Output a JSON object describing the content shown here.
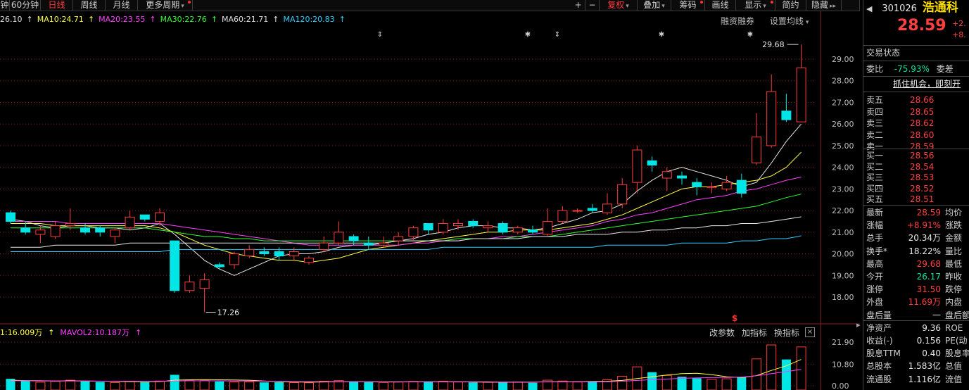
{
  "toolbar": {
    "tabs": [
      {
        "label": "钟",
        "x": 0,
        "w": 14
      },
      {
        "label": "60分钟",
        "x": 14,
        "w": 44
      },
      {
        "label": "日线",
        "x": 58,
        "w": 46,
        "active": true
      },
      {
        "label": "周线",
        "x": 104,
        "w": 46
      },
      {
        "label": "月线",
        "x": 150,
        "w": 46
      },
      {
        "label": "更多周期",
        "x": 196,
        "w": 78,
        "dot": true,
        "dropdown": true
      }
    ],
    "right_buttons": [
      {
        "label": "+",
        "x": 812,
        "w": 20
      },
      {
        "label": "−",
        "x": 832,
        "w": 20
      },
      {
        "label": "复权",
        "x": 852,
        "w": 54,
        "active": true,
        "dropdown": true
      },
      {
        "label": "叠加",
        "x": 906,
        "w": 48,
        "dropdown": true
      },
      {
        "label": "筹码",
        "x": 954,
        "w": 48,
        "dot": true
      },
      {
        "label": "画线",
        "x": 1002,
        "w": 44
      },
      {
        "label": "显示",
        "x": 1046,
        "w": 56,
        "dot": true,
        "dropdown": true
      },
      {
        "label": "简约",
        "x": 1102,
        "w": 44
      },
      {
        "label": "隐藏",
        "x": 1146,
        "w": 50,
        "arrow": "▸▸"
      },
      {
        "label": "",
        "x": 1196,
        "w": 26
      }
    ]
  },
  "ma_legend": [
    {
      "text": "26.10",
      "color": "#e0e0e0"
    },
    {
      "text": "MA10:24.71",
      "color": "#ffff40"
    },
    {
      "text": "MA20:23.55",
      "color": "#ff40ff"
    },
    {
      "text": "MA30:22.76",
      "color": "#30ff30"
    },
    {
      "text": "MA60:21.71",
      "color": "#e0e0e0"
    },
    {
      "text": "MA120:20.83",
      "color": "#30d0ff"
    }
  ],
  "main_right_labels": {
    "rzrq": "融资融券",
    "set_ma": "设置均线"
  },
  "price_axis": {
    "ticks": [
      "29.00",
      "28.00",
      "27.00",
      "26.00",
      "25.00",
      "24.00",
      "23.00",
      "22.00",
      "21.00",
      "20.00",
      "19.00",
      "18.00"
    ]
  },
  "annotations": {
    "high": "29.68",
    "low": "17.26",
    "s_marker": "$"
  },
  "volume": {
    "legend": [
      {
        "text": "1:16.009万",
        "color": "#ffff40"
      },
      {
        "text": "MAVOL2:10.187万",
        "color": "#ff40ff"
      }
    ],
    "buttons": [
      "改参数",
      "加指标",
      "换指标"
    ],
    "close": "×",
    "axis_ticks": [
      "21.90",
      "10.80",
      "0.00"
    ]
  },
  "chart_data": {
    "type": "candlestick",
    "ylim": [
      17.3,
      29.7
    ],
    "candles": [
      {
        "o": 21.9,
        "c": 21.5,
        "h": 22.0,
        "l": 21.4
      },
      {
        "o": 21.2,
        "c": 21.0,
        "h": 21.5,
        "l": 20.9
      },
      {
        "o": 20.9,
        "c": 21.1,
        "h": 21.3,
        "l": 20.5
      },
      {
        "o": 20.8,
        "c": 21.3,
        "h": 21.5,
        "l": 20.7
      },
      {
        "o": 21.3,
        "c": 21.4,
        "h": 22.1,
        "l": 21.1
      },
      {
        "o": 21.2,
        "c": 21.0,
        "h": 21.4,
        "l": 20.9
      },
      {
        "o": 21.2,
        "c": 21.0,
        "h": 21.3,
        "l": 20.8
      },
      {
        "o": 20.8,
        "c": 21.1,
        "h": 21.2,
        "l": 20.5
      },
      {
        "o": 21.2,
        "c": 21.7,
        "h": 22.0,
        "l": 21.1
      },
      {
        "o": 21.8,
        "c": 21.6,
        "h": 21.8,
        "l": 21.5
      },
      {
        "o": 21.5,
        "c": 21.9,
        "h": 22.1,
        "l": 21.3
      },
      {
        "o": 20.6,
        "c": 18.3,
        "h": 20.6,
        "l": 18.2
      },
      {
        "o": 18.3,
        "c": 18.7,
        "h": 19.0,
        "l": 18.2
      },
      {
        "o": 18.4,
        "c": 18.8,
        "h": 19.1,
        "l": 17.3
      },
      {
        "o": 19.5,
        "c": 19.4,
        "h": 19.6,
        "l": 19.3
      },
      {
        "o": 19.5,
        "c": 20.0,
        "h": 20.1,
        "l": 19.3
      },
      {
        "o": 19.9,
        "c": 20.2,
        "h": 20.4,
        "l": 19.8
      },
      {
        "o": 20.1,
        "c": 20.0,
        "h": 20.3,
        "l": 19.9
      },
      {
        "o": 20.1,
        "c": 19.9,
        "h": 20.3,
        "l": 19.7
      },
      {
        "o": 19.9,
        "c": 20.1,
        "h": 20.3,
        "l": 19.7
      },
      {
        "o": 19.6,
        "c": 19.8,
        "h": 19.9,
        "l": 19.5
      },
      {
        "o": 20.2,
        "c": 20.5,
        "h": 20.8,
        "l": 20.1
      },
      {
        "o": 20.5,
        "c": 21.0,
        "h": 21.5,
        "l": 20.4
      },
      {
        "o": 20.8,
        "c": 20.6,
        "h": 20.9,
        "l": 20.4
      },
      {
        "o": 20.5,
        "c": 20.4,
        "h": 20.8,
        "l": 20.2
      },
      {
        "o": 20.4,
        "c": 20.5,
        "h": 20.8,
        "l": 20.3
      },
      {
        "o": 20.6,
        "c": 20.8,
        "h": 21.0,
        "l": 20.4
      },
      {
        "o": 20.8,
        "c": 21.2,
        "h": 21.3,
        "l": 20.6
      },
      {
        "o": 21.4,
        "c": 21.1,
        "h": 21.4,
        "l": 20.9
      },
      {
        "o": 21.0,
        "c": 21.4,
        "h": 21.6,
        "l": 20.9
      },
      {
        "o": 21.3,
        "c": 21.4,
        "h": 21.6,
        "l": 21.1
      },
      {
        "o": 21.5,
        "c": 21.3,
        "h": 21.6,
        "l": 21.2
      },
      {
        "o": 21.2,
        "c": 21.3,
        "h": 21.5,
        "l": 21.0
      },
      {
        "o": 21.4,
        "c": 21.0,
        "h": 21.5,
        "l": 20.9
      },
      {
        "o": 21.0,
        "c": 21.2,
        "h": 21.3,
        "l": 20.9
      },
      {
        "o": 21.1,
        "c": 21.0,
        "h": 21.3,
        "l": 20.9
      },
      {
        "o": 20.9,
        "c": 21.5,
        "h": 22.1,
        "l": 20.8
      },
      {
        "o": 21.5,
        "c": 22.0,
        "h": 22.2,
        "l": 21.4
      },
      {
        "o": 22.0,
        "c": 22.0,
        "h": 22.1,
        "l": 21.9
      },
      {
        "o": 22.1,
        "c": 22.0,
        "h": 22.3,
        "l": 21.9
      },
      {
        "o": 21.9,
        "c": 22.3,
        "h": 22.8,
        "l": 21.8
      },
      {
        "o": 22.3,
        "c": 23.2,
        "h": 23.5,
        "l": 22.1
      },
      {
        "o": 23.3,
        "c": 24.8,
        "h": 25.0,
        "l": 22.8
      },
      {
        "o": 24.3,
        "c": 24.1,
        "h": 24.5,
        "l": 23.8
      },
      {
        "o": 23.5,
        "c": 23.8,
        "h": 24.0,
        "l": 22.9
      },
      {
        "o": 23.6,
        "c": 23.5,
        "h": 23.8,
        "l": 23.2
      },
      {
        "o": 23.3,
        "c": 23.1,
        "h": 23.5,
        "l": 22.7
      },
      {
        "o": 23.1,
        "c": 23.1,
        "h": 23.3,
        "l": 22.8
      },
      {
        "o": 23.0,
        "c": 23.3,
        "h": 23.6,
        "l": 22.9
      },
      {
        "o": 23.4,
        "c": 22.8,
        "h": 23.7,
        "l": 22.6
      },
      {
        "o": 24.2,
        "c": 25.4,
        "h": 26.5,
        "l": 24.1
      },
      {
        "o": 25.0,
        "c": 27.5,
        "h": 28.3,
        "l": 24.9
      },
      {
        "o": 26.6,
        "c": 26.2,
        "h": 27.4,
        "l": 26.1
      },
      {
        "o": 26.1,
        "c": 28.6,
        "h": 29.68,
        "l": 26.1
      }
    ],
    "ma_lines": [
      {
        "name": "MA5",
        "color": "#e8e8e8",
        "values": [
          21.6,
          21.5,
          21.3,
          21.2,
          21.3,
          21.3,
          21.2,
          21.2,
          21.1,
          21.2,
          21.4,
          20.9,
          20.3,
          19.7,
          19.3,
          19.0,
          19.3,
          19.6,
          19.9,
          20.0,
          20.0,
          20.1,
          20.3,
          20.4,
          20.4,
          20.5,
          20.6,
          20.7,
          20.9,
          21.0,
          21.2,
          21.3,
          21.3,
          21.2,
          21.2,
          21.1,
          21.2,
          21.4,
          21.6,
          21.9,
          22.0,
          22.3,
          22.9,
          23.4,
          23.8,
          24.0,
          23.8,
          23.6,
          23.4,
          23.1,
          23.3,
          24.2,
          25.2,
          26.0
        ]
      },
      {
        "name": "MA10",
        "color": "#ffff40",
        "values": [
          21.4,
          21.4,
          21.4,
          21.3,
          21.3,
          21.3,
          21.3,
          21.3,
          21.3,
          21.3,
          21.2,
          21.0,
          20.7,
          20.4,
          20.2,
          20.0,
          19.9,
          19.8,
          19.7,
          19.7,
          19.6,
          19.7,
          19.8,
          20.0,
          20.2,
          20.3,
          20.4,
          20.5,
          20.6,
          20.7,
          20.8,
          20.9,
          21.0,
          21.0,
          21.1,
          21.1,
          21.1,
          21.2,
          21.3,
          21.4,
          21.6,
          21.8,
          22.1,
          22.4,
          22.7,
          23.0,
          23.1,
          23.1,
          23.2,
          23.3,
          23.4,
          23.6,
          24.0,
          24.7
        ]
      },
      {
        "name": "MA20",
        "color": "#ff40ff",
        "values": [
          21.5,
          21.5,
          21.5,
          21.5,
          21.4,
          21.4,
          21.4,
          21.4,
          21.4,
          21.4,
          21.4,
          21.3,
          21.2,
          21.1,
          21.0,
          20.9,
          20.8,
          20.7,
          20.6,
          20.5,
          20.4,
          20.4,
          20.4,
          20.4,
          20.4,
          20.4,
          20.4,
          20.5,
          20.5,
          20.6,
          20.6,
          20.7,
          20.7,
          20.8,
          20.8,
          20.9,
          21.0,
          21.1,
          21.2,
          21.3,
          21.5,
          21.6,
          21.8,
          21.9,
          22.1,
          22.3,
          22.5,
          22.6,
          22.7,
          22.9,
          23.0,
          23.2,
          23.4,
          23.55
        ]
      },
      {
        "name": "MA30",
        "color": "#30ff30",
        "values": [
          21.2,
          21.2,
          21.2,
          21.2,
          21.2,
          21.2,
          21.2,
          21.2,
          21.2,
          21.2,
          21.1,
          21.0,
          20.9,
          20.8,
          20.8,
          20.7,
          20.7,
          20.6,
          20.6,
          20.6,
          20.6,
          20.6,
          20.6,
          20.6,
          20.6,
          20.6,
          20.6,
          20.6,
          20.6,
          20.6,
          20.7,
          20.7,
          20.7,
          20.7,
          20.8,
          20.8,
          20.8,
          20.9,
          21.0,
          21.1,
          21.2,
          21.3,
          21.4,
          21.5,
          21.6,
          21.7,
          21.8,
          21.9,
          22.0,
          22.1,
          22.2,
          22.4,
          22.6,
          22.76
        ]
      },
      {
        "name": "MA60",
        "color": "#e8e8e8",
        "values": [
          20.3,
          20.3,
          20.3,
          20.4,
          20.4,
          20.4,
          20.4,
          20.4,
          20.5,
          20.5,
          20.5,
          20.5,
          20.5,
          20.5,
          20.5,
          20.5,
          20.5,
          20.5,
          20.5,
          20.5,
          20.5,
          20.5,
          20.5,
          20.5,
          20.5,
          20.5,
          20.6,
          20.6,
          20.6,
          20.6,
          20.6,
          20.7,
          20.7,
          20.7,
          20.7,
          20.8,
          20.8,
          20.8,
          20.9,
          20.9,
          20.9,
          21.0,
          21.0,
          21.1,
          21.1,
          21.2,
          21.2,
          21.3,
          21.3,
          21.4,
          21.4,
          21.5,
          21.6,
          21.71
        ]
      },
      {
        "name": "MA120",
        "color": "#30d0ff",
        "values": [
          20.1,
          20.1,
          20.1,
          20.1,
          20.1,
          20.1,
          20.1,
          20.1,
          20.1,
          20.1,
          20.1,
          20.2,
          20.2,
          20.2,
          20.2,
          20.2,
          20.2,
          20.2,
          20.2,
          20.2,
          20.2,
          20.2,
          20.2,
          20.2,
          20.2,
          20.2,
          20.2,
          20.2,
          20.2,
          20.3,
          20.3,
          20.3,
          20.3,
          20.3,
          20.3,
          20.3,
          20.3,
          20.3,
          20.3,
          20.3,
          20.4,
          20.4,
          20.4,
          20.4,
          20.4,
          20.5,
          20.5,
          20.5,
          20.5,
          20.6,
          20.6,
          20.7,
          20.7,
          20.83
        ]
      }
    ],
    "volume": {
      "ylim": [
        0,
        21.9
      ],
      "values": [
        3.5,
        2.5,
        1.8,
        2.2,
        2.8,
        2.3,
        1.9,
        1.6,
        2.1,
        1.8,
        2.4,
        5.5,
        2.8,
        2.6,
        2.2,
        1.9,
        2.0,
        1.7,
        1.8,
        1.6,
        1.5,
        2.3,
        2.6,
        2.1,
        1.8,
        1.7,
        1.9,
        2.2,
        2.0,
        2.3,
        1.9,
        1.7,
        1.8,
        1.6,
        1.9,
        1.5,
        2.8,
        2.4,
        1.9,
        2.2,
        3.0,
        4.8,
        9.5,
        6.8,
        5.2,
        4.5,
        3.8,
        3.2,
        3.5,
        4.5,
        13.5,
        20.5,
        13.2,
        19.5
      ],
      "mavol": [
        2.8,
        2.6,
        2.5,
        2.4,
        2.5,
        2.4,
        2.3,
        2.2,
        2.1,
        2.0,
        2.1,
        2.8,
        3.0,
        3.1,
        3.0,
        2.9,
        2.8,
        2.4,
        2.0,
        1.9,
        1.8,
        1.9,
        2.0,
        2.1,
        2.0,
        1.9,
        1.9,
        2.0,
        2.0,
        2.0,
        2.0,
        1.9,
        1.8,
        1.8,
        1.8,
        1.8,
        2.0,
        2.1,
        2.1,
        2.2,
        2.3,
        2.7,
        3.6,
        4.5,
        5.4,
        6.1,
        6.3,
        5.6,
        4.5,
        4.1,
        5.1,
        7.7,
        10.0,
        13.2
      ],
      "mavol2": [
        2.5,
        2.5,
        2.4,
        2.4,
        2.4,
        2.4,
        2.3,
        2.3,
        2.3,
        2.2,
        2.2,
        2.4,
        2.5,
        2.5,
        2.5,
        2.4,
        2.4,
        2.3,
        2.2,
        2.1,
        2.1,
        2.1,
        2.1,
        2.1,
        2.1,
        2.0,
        2.0,
        2.0,
        2.0,
        2.0,
        2.0,
        2.0,
        2.0,
        1.9,
        1.9,
        1.9,
        2.0,
        2.0,
        2.0,
        2.0,
        2.1,
        2.3,
        2.7,
        3.1,
        3.4,
        3.7,
        4.0,
        4.1,
        4.2,
        4.3,
        5.0,
        6.1,
        7.1,
        8.2
      ]
    }
  },
  "quote": {
    "code": "301026",
    "name": "浩通科",
    "price": "28.59",
    "change": "+2.",
    "change_pct": "+8.",
    "trade_status": "交易状态",
    "weibi_label": "委比",
    "weibi_value": "-75.93%",
    "weicha_label": "委差",
    "banner": "抓住机会，即刻开",
    "sells": [
      {
        "label": "卖五",
        "price": "28.66"
      },
      {
        "label": "卖四",
        "price": "28.65"
      },
      {
        "label": "卖三",
        "price": "28.62"
      },
      {
        "label": "卖二",
        "price": "28.60"
      },
      {
        "label": "卖一",
        "price": "28.59"
      }
    ],
    "buys": [
      {
        "label": "买一",
        "price": "28.56"
      },
      {
        "label": "买二",
        "price": "28.54"
      },
      {
        "label": "买三",
        "price": "28.53"
      },
      {
        "label": "买四",
        "price": "28.52"
      },
      {
        "label": "买五",
        "price": "28.51"
      }
    ],
    "stats": [
      {
        "label": "最新",
        "value": "28.59",
        "color": "red",
        "label2": "均价"
      },
      {
        "label": "涨幅",
        "value": "+8.91%",
        "color": "red",
        "label2": "涨跌"
      },
      {
        "label": "总手",
        "value": "20.34万",
        "color": "white",
        "label2": "金额"
      },
      {
        "label": "换手*",
        "value": "18.22%",
        "color": "white",
        "label2": "量比"
      },
      {
        "label": "最高",
        "value": "29.68",
        "color": "red",
        "label2": "最低"
      },
      {
        "label": "今开",
        "value": "26.17",
        "color": "green",
        "label2": "昨收"
      },
      {
        "label": "涨停",
        "value": "31.50",
        "color": "red",
        "label2": "跌停"
      },
      {
        "label": "外盘",
        "value": "11.69万",
        "color": "red",
        "label2": "内盘"
      },
      {
        "label": "盘后量",
        "value": "一",
        "color": "white",
        "label2": "盘后额"
      },
      {
        "label": "净资产",
        "value": "9.36",
        "color": "white",
        "label2": "ROE"
      },
      {
        "label": "收益(-)",
        "value": "0.156",
        "color": "white",
        "label2": "PE(动"
      },
      {
        "label": "股息TTM",
        "value": "0.40",
        "color": "white",
        "label2": "股息率"
      },
      {
        "label": "总股本",
        "value": "1.583亿",
        "color": "white",
        "label2": "总值"
      },
      {
        "label": "流通股",
        "value": "1.116亿",
        "color": "white",
        "label2": "流值"
      }
    ]
  },
  "colors": {
    "up": "#ff3c3c",
    "down": "#00e6e6",
    "grid": "#8a1f1f",
    "axis_text": "#bdbdbd"
  }
}
